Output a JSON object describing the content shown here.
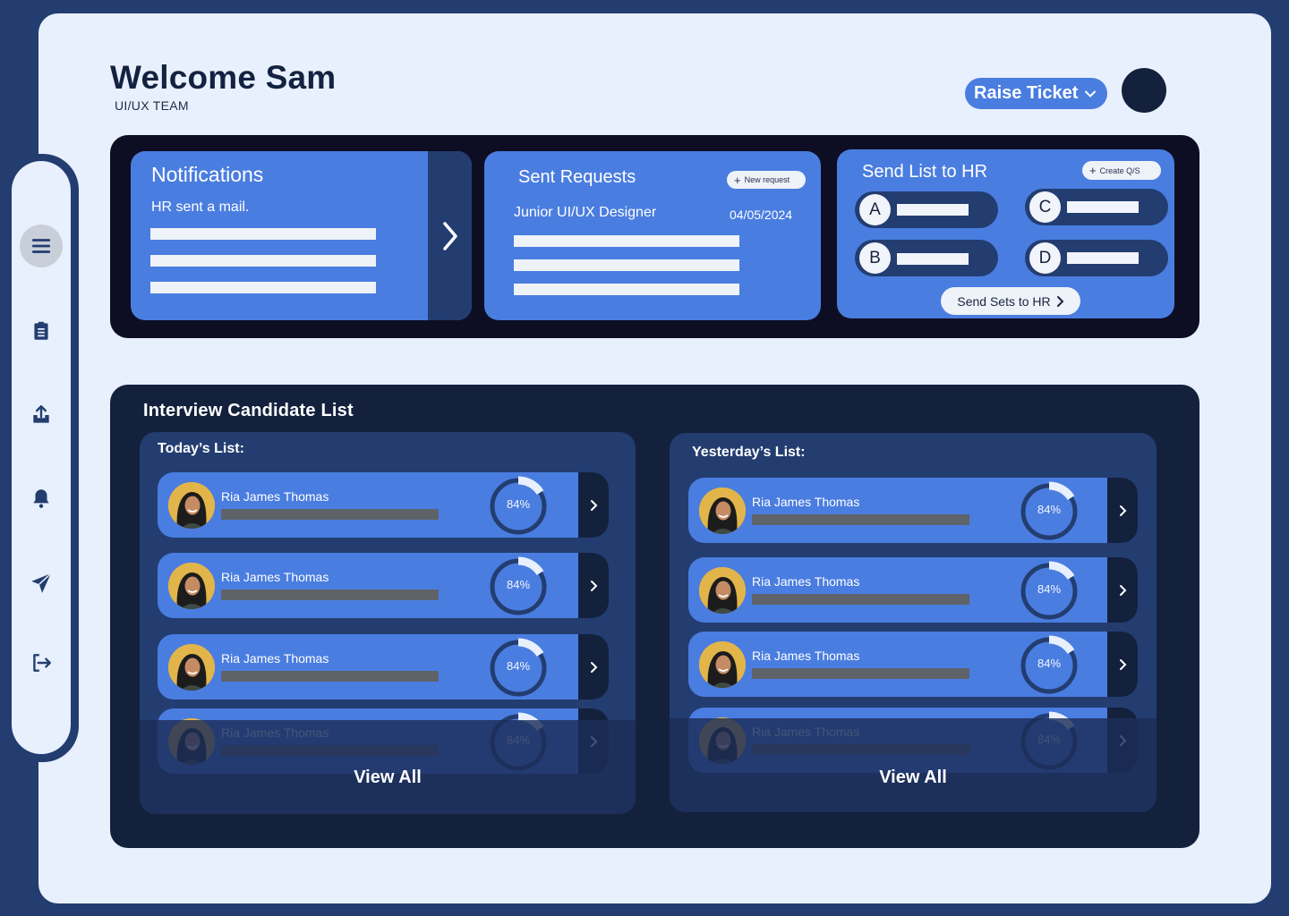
{
  "header": {
    "welcome": "Welcome Sam",
    "team": "UI/UX TEAM",
    "raise_ticket": "Raise Ticket"
  },
  "sidebar": {
    "items": [
      {
        "icon": "menu-icon"
      },
      {
        "icon": "clipboard-icon"
      },
      {
        "icon": "upload-icon"
      },
      {
        "icon": "bell-icon"
      },
      {
        "icon": "send-icon"
      },
      {
        "icon": "logout-icon"
      }
    ]
  },
  "notifications": {
    "title": "Notifications",
    "message": "HR sent a mail."
  },
  "sent_requests": {
    "title": "Sent Requests",
    "new_request": "New request",
    "role": "Junior UI/UX Designer",
    "date": "04/05/2024"
  },
  "send_list": {
    "title": "Send List to HR",
    "create": "Create Q/S",
    "slots": [
      "A",
      "B",
      "C",
      "D"
    ],
    "send_sets": "Send Sets to HR"
  },
  "interview": {
    "title": "Interview Candidate List",
    "today": {
      "label": "Today’s List:",
      "view_all": "View All",
      "rows": [
        {
          "name": "Ria James Thomas",
          "score": "84%"
        },
        {
          "name": "Ria James Thomas",
          "score": "84%"
        },
        {
          "name": "Ria James Thomas",
          "score": "84%"
        },
        {
          "name": "Ria James Thomas",
          "score": "84%"
        }
      ]
    },
    "yesterday": {
      "label": "Yesterday’s List:",
      "view_all": "View All",
      "rows": [
        {
          "name": "Ria James Thomas",
          "score": "84%"
        },
        {
          "name": "Ria James Thomas",
          "score": "84%"
        },
        {
          "name": "Ria James Thomas",
          "score": "84%"
        },
        {
          "name": "Ria James Thomas",
          "score": "84%"
        }
      ]
    }
  },
  "colors": {
    "accent": "#4a7de0",
    "navy": "#233d70",
    "dark": "#14213d",
    "page_bg": "#e8f0fd"
  }
}
